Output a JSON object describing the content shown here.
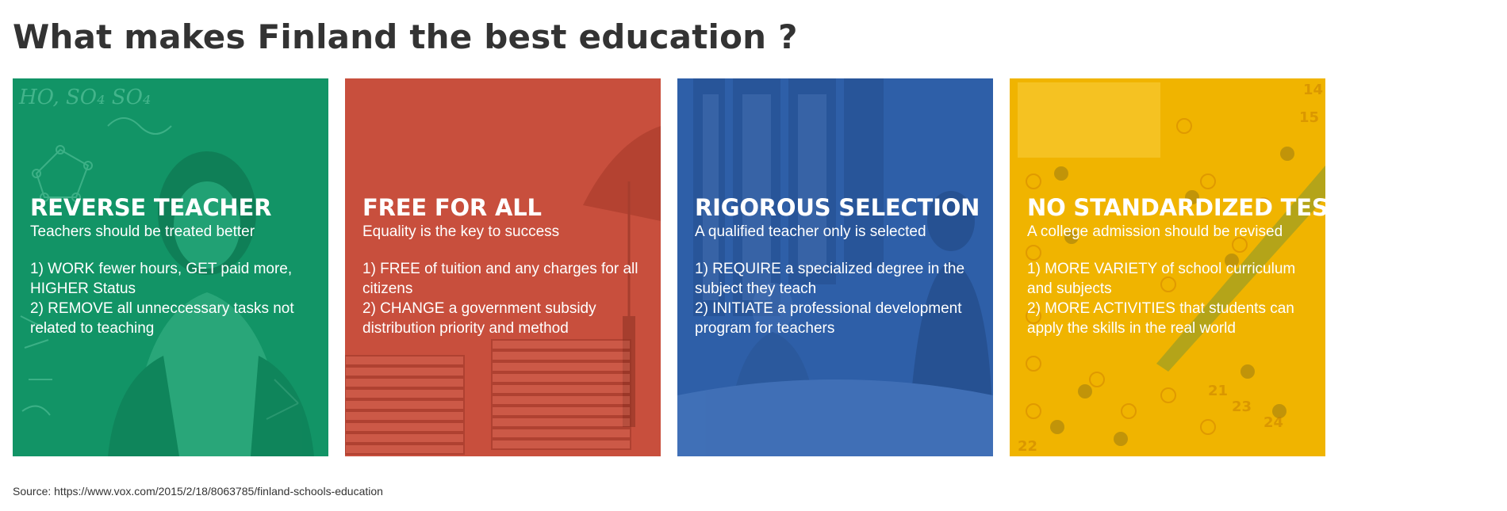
{
  "title": "What makes Finland the best education ?",
  "cards": [
    {
      "heading": "REVERSE TEACHER",
      "subtitle": "Teachers should be treated better",
      "points": [
        "1) WORK fewer hours, GET paid more, HIGHER Status",
        "2) REMOVE all unneccessary tasks not related to teaching"
      ],
      "color": "#149a6b",
      "image": "teacher-at-chalkboard-photo"
    },
    {
      "heading": "FREE FOR ALL",
      "subtitle": "Equality is the key to success",
      "points": [
        "1) FREE of tuition and any charges for all citizens",
        "2) CHANGE a government subsidy distribution priority and method"
      ],
      "color": "#c84f3d",
      "image": "coins-and-graduation-cap-photo"
    },
    {
      "heading": "RIGOROUS SELECTION",
      "subtitle": "A qualified teacher only is selected",
      "points": [
        "1) REQUIRE a specialized degree in the subject they teach",
        "2) INITIATE a professional development program for teachers"
      ],
      "color": "#2e5fa8",
      "image": "meeting-room-photo"
    },
    {
      "heading": "NO STANDARDIZED TEST",
      "subtitle": "A college admission should be revised",
      "points": [
        "1) MORE VARIETY of school curriculum and subjects",
        "2) MORE ACTIVITIES that students can apply the skills in the real world"
      ],
      "color": "#f0b400",
      "image": "answer-sheet-and-pencil-photo"
    }
  ],
  "source": "Source: https://www.vox.com/2015/2/18/8063785/finland-schools-education"
}
